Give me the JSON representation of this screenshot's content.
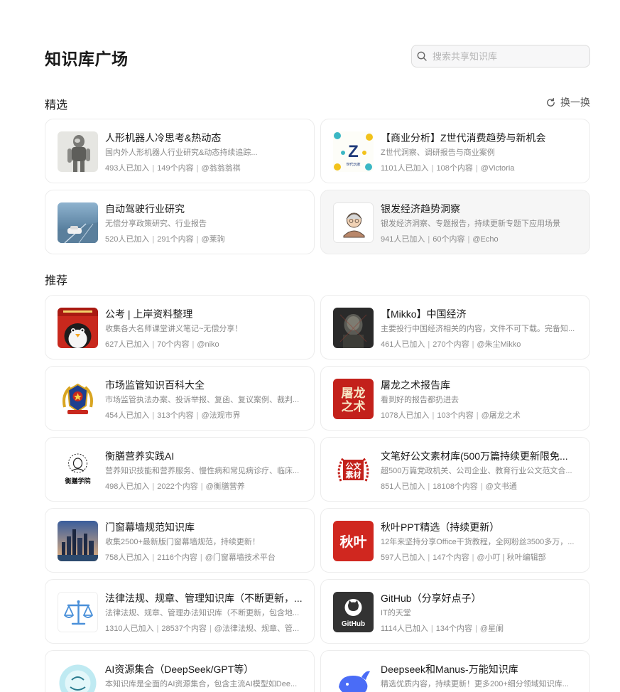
{
  "page": {
    "title": "知识库广场",
    "search_placeholder": "搜索共享知识库"
  },
  "featured": {
    "title": "精选",
    "refresh_label": "换一换",
    "cards": [
      {
        "title": "人形机器人冷思考&热动态",
        "desc": "国内外人形机器人行业研究&动态持续追踪...",
        "members": "493人已加入",
        "contents": "149个内容",
        "owner": "@翁翁翁祺",
        "thumb": "robot-image"
      },
      {
        "title": "【商业分析】Z世代消费趋势与新机会",
        "desc": "Z世代洞察、调研报告与商业案例",
        "members": "1101人已加入",
        "contents": "108个内容",
        "owner": "@Victoria",
        "thumb": "gen-z-logo",
        "thumb_text": "Z",
        "thumb_sub": "世代玩家"
      },
      {
        "title": "自动驾驶行业研究",
        "desc": "无偿分享政策研究、行业报告",
        "members": "520人已加入",
        "contents": "291个内容",
        "owner": "@莱驹",
        "thumb": "autonomous-car-image"
      },
      {
        "title": "银发经济趋势洞察",
        "desc": "银发经济洞察、专题报告，持续更新专题下应用场景",
        "members": "941人已加入",
        "contents": "60个内容",
        "owner": "@Echo",
        "thumb": "elderly-avatar"
      }
    ]
  },
  "recommended": {
    "title": "推荐",
    "cards": [
      {
        "title": "公考 | 上岸资料整理",
        "desc": "收集各大名师课堂讲义笔记~无偿分享！",
        "members": "627人已加入",
        "contents": "70个内容",
        "owner": "@niko",
        "thumb": "penguin-image"
      },
      {
        "title": "【Mikko】中国经济",
        "desc": "主要投行中国经济相关的内容，文件不可下载。完备知...",
        "members": "461人已加入",
        "contents": "270个内容",
        "owner": "@朱尘Mikko",
        "thumb": "portrait-image"
      },
      {
        "title": "市场监管知识百科大全",
        "desc": "市场监管执法办案、投诉举报、复函、复议案例、裁判...",
        "members": "454人已加入",
        "contents": "313个内容",
        "owner": "@法观市界",
        "thumb": "emblem-image"
      },
      {
        "title": "屠龙之术报告库",
        "desc": "看到好的报告都扔进去",
        "members": "1078人已加入",
        "contents": "103个内容",
        "owner": "@屠龙之术",
        "thumb": "calligraphy-image",
        "thumb_text": "屠龙之术"
      },
      {
        "title": "衡膳营养实践AI",
        "desc": "营养知识技能和营养服务、慢性病和常见病诊疗、临床...",
        "members": "498人已加入",
        "contents": "2022个内容",
        "owner": "@衡膳营养",
        "thumb": "portrait-sketch-logo",
        "thumb_text": "衡膳学院"
      },
      {
        "title": "文笔好公文素材库(500万篇持续更新限免...",
        "desc": "超500万篇党政机关、公司企业、教育行业公文范文合...",
        "members": "851人已加入",
        "contents": "18108个内容",
        "owner": "@文书通",
        "thumb": "seal-logo",
        "thumb_text": "公文素材"
      },
      {
        "title": "门窗幕墙规范知识库",
        "desc": "收集2500+最新版门窗幕墙规范，持续更新！",
        "members": "758人已加入",
        "contents": "2116个内容",
        "owner": "@门窗幕墙技术平台",
        "thumb": "city-skyline-image"
      },
      {
        "title": "秋叶PPT精选（持续更新）",
        "desc": "12年来坚持分享Office干货教程，全网粉丝3500多万，...",
        "members": "597人已加入",
        "contents": "147个内容",
        "owner": "@小叮 | 秋叶编辑部",
        "thumb": "qiuye-logo",
        "thumb_text": "秋叶"
      },
      {
        "title": "法律法规、规章、管理知识库（不断更新，...",
        "desc": "法律法规、规章、管理办法知识库（不断更新，包含地...",
        "members": "1310人已加入",
        "contents": "28537个内容",
        "owner": "@法律法规、规章、管...",
        "thumb": "scales-icon"
      },
      {
        "title": "GitHub（分享好点子）",
        "desc": "IT的天堂",
        "members": "1114人已加入",
        "contents": "134个内容",
        "owner": "@星阑",
        "thumb": "github-logo",
        "thumb_text": "GitHub"
      },
      {
        "title": "AI资源集合（DeepSeek/GPT等）",
        "desc": "本知识库是全面的AI资源集合，包含主流AI模型如Dee...",
        "members": "",
        "contents": "",
        "owner": "",
        "thumb": "ai-collection-logo"
      },
      {
        "title": "Deepseek和Manus-万能知识库",
        "desc": "精选优质内容，持续更新！更多200+细分领域知识库...",
        "members": "",
        "contents": "",
        "owner": "",
        "thumb": "deepseek-whale-logo"
      }
    ]
  },
  "colors": {
    "accent": "#1a1a1a",
    "muted": "#8a8a8a",
    "border": "#ececec",
    "hover_card": "#f6f6f6"
  }
}
